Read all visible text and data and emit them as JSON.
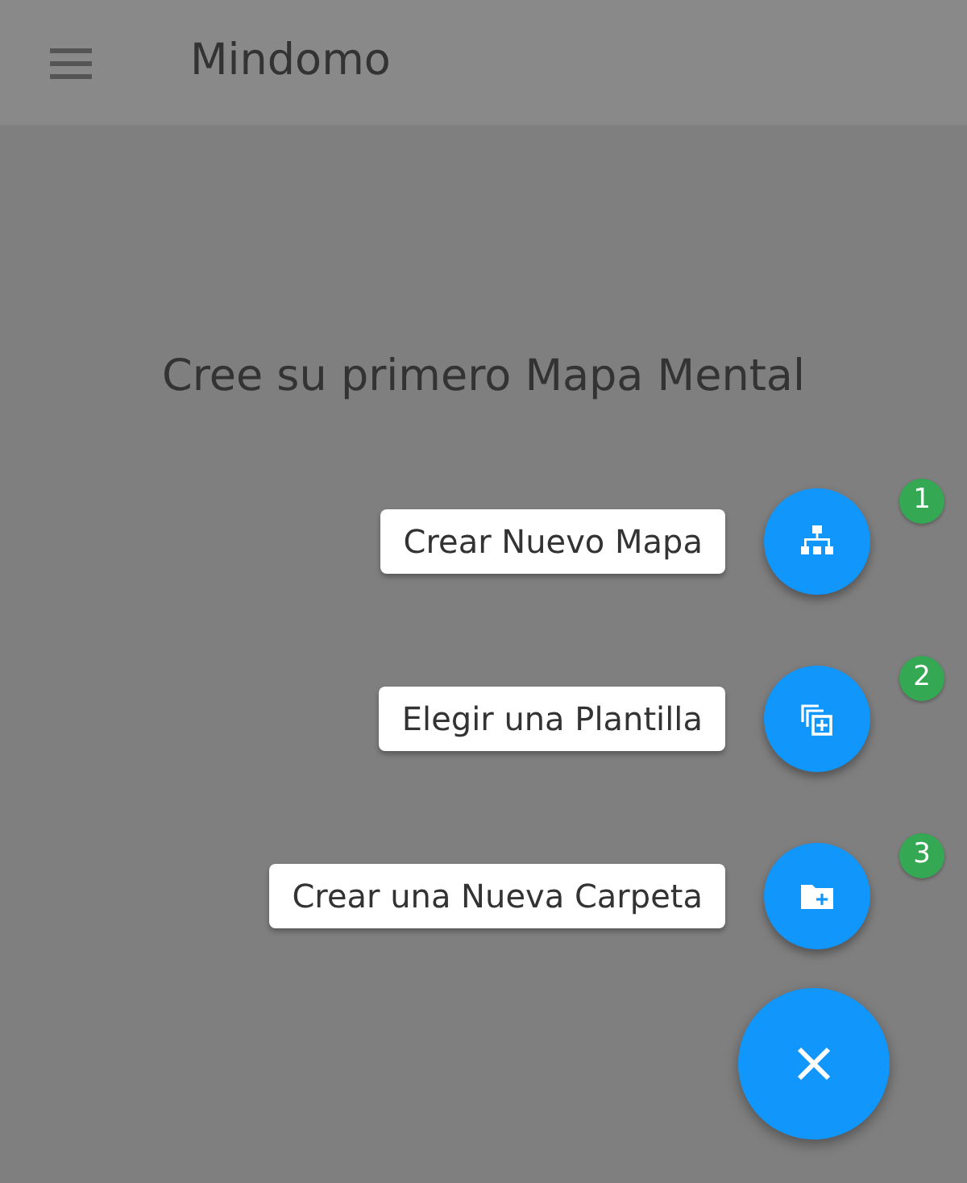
{
  "app_bar": {
    "title": "Mindomo"
  },
  "heading": "Cree su primero Mapa Mental",
  "actions": [
    {
      "label": "Crear Nuevo Mapa",
      "kind": "map",
      "step": "1"
    },
    {
      "label": "Elegir una Plantilla",
      "kind": "template",
      "step": "2"
    },
    {
      "label": "Crear una Nueva Carpeta",
      "kind": "folder",
      "step": "3"
    }
  ]
}
